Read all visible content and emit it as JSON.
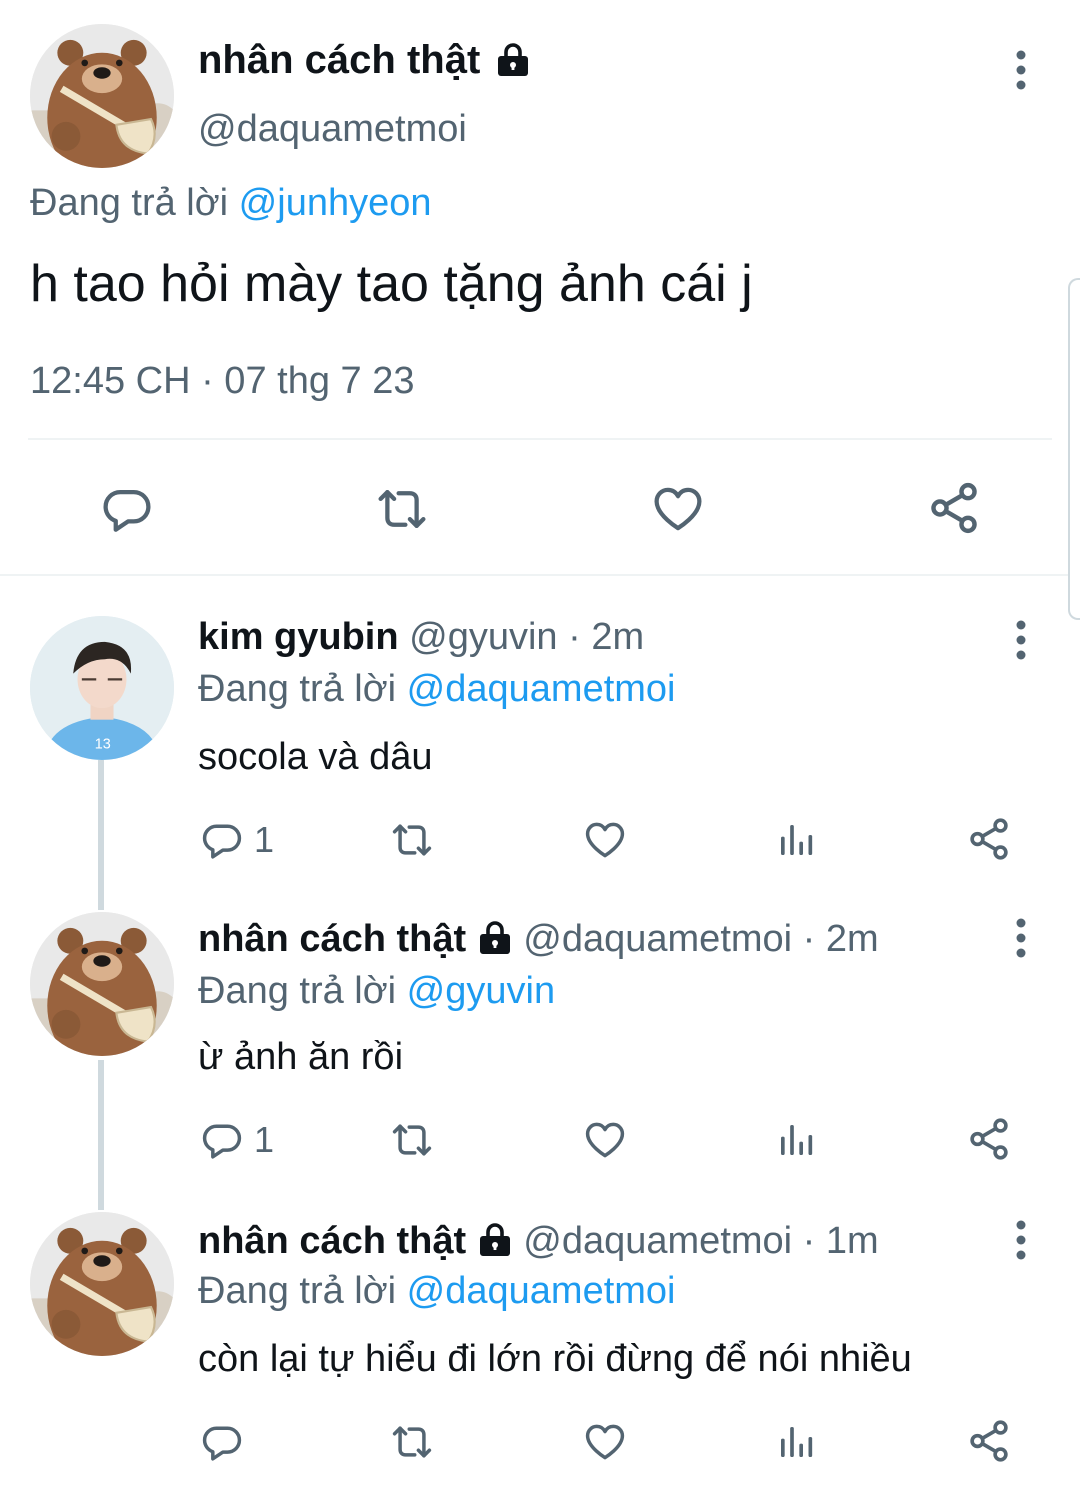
{
  "main_tweet": {
    "name": "nhân cách thật",
    "handle": "@daquametmoi",
    "reply_prefix": "Đang trả lời",
    "reply_to": "@junhyeon",
    "text": "h tao hỏi mày tao tặng ảnh cái j",
    "timestamp": "12:45 CH · 07 thg 7 23",
    "actions": [
      "reply-icon",
      "retweet-icon",
      "like-icon",
      "share-icon"
    ]
  },
  "replies": [
    {
      "name": "kim gyubin",
      "handle": "@gyuvin",
      "time": "· 2m",
      "reply_prefix": "Đang trả lời",
      "reply_to": "@daquametmoi",
      "text": "socola và dâu",
      "reply_count": "1",
      "locked": false
    },
    {
      "name": "nhân cách thật",
      "handle": "@daquametmoi",
      "time": "· 2m",
      "reply_prefix": "Đang trả lời",
      "reply_to": "@gyuvin",
      "text": "ừ ảnh ăn rồi",
      "reply_count": "1",
      "locked": true
    },
    {
      "name": "nhân cách thật",
      "handle": "@daquametmoi",
      "time": "· 1m",
      "reply_prefix": "Đang trả lời",
      "reply_to": "@daquametmoi",
      "text": "còn lại tự hiểu đi lớn rồi đừng để nói nhiều",
      "reply_count": "",
      "locked": true
    }
  ],
  "colors": {
    "link": "#1d9bf0",
    "secondary_text": "#536471",
    "primary_text": "#0f1419",
    "divider": "#eff3f4"
  }
}
